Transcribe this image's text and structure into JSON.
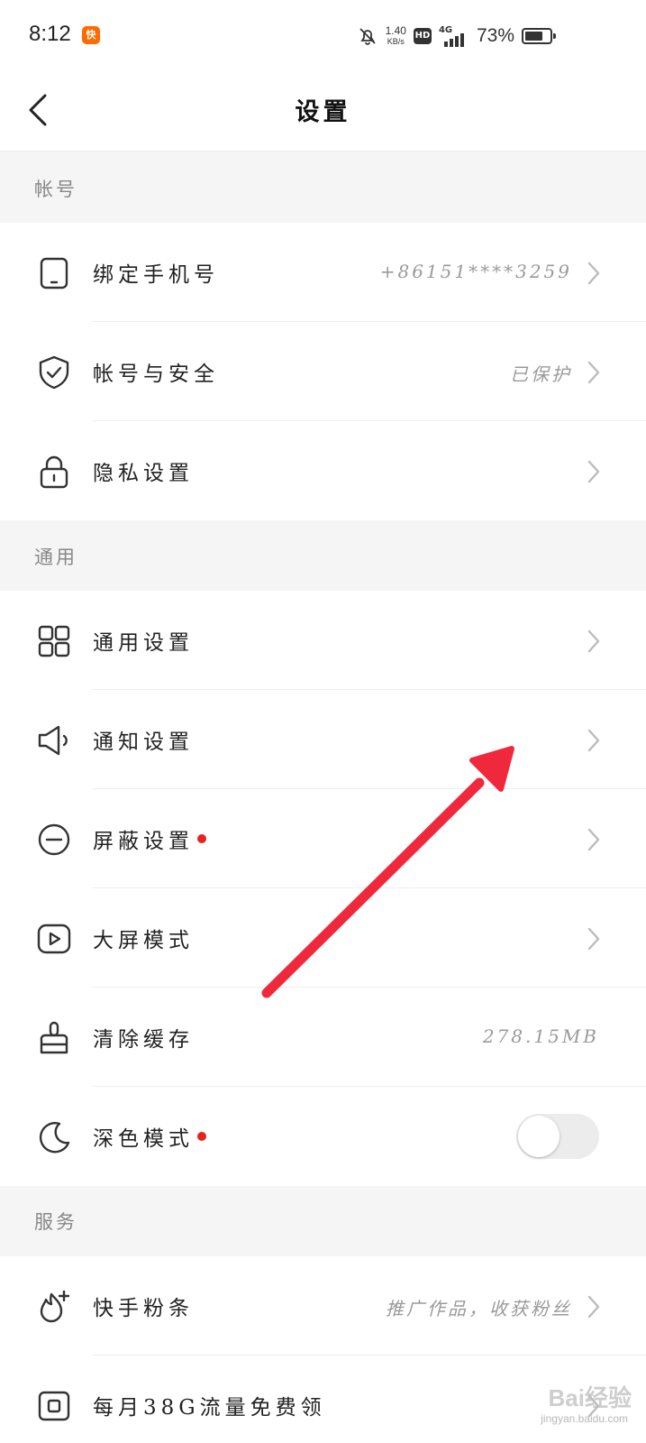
{
  "status_bar": {
    "time": "8:12",
    "app_icon": "kuaishou-app-icon",
    "net_speed_value": "1.40",
    "net_speed_unit": "KB/s",
    "hd_badge": "HD",
    "network_type": "4G",
    "battery_percent": "73%",
    "battery_level": 0.73
  },
  "header": {
    "title": "设置",
    "back_icon": "chevron-left-icon"
  },
  "sections": {
    "account": {
      "title": "帐号",
      "items": [
        {
          "label": "绑定手机号",
          "value": "+86151****3259",
          "icon": "phone-icon"
        },
        {
          "label": "帐号与安全",
          "value": "已保护",
          "icon": "shield-check-icon"
        },
        {
          "label": "隐私设置",
          "value": "",
          "icon": "lock-icon"
        }
      ]
    },
    "general": {
      "title": "通用",
      "items": [
        {
          "label": "通用设置",
          "icon": "grid-icon"
        },
        {
          "label": "通知设置",
          "icon": "speaker-icon"
        },
        {
          "label": "屏蔽设置",
          "icon": "minus-circle-icon",
          "has_dot": true
        },
        {
          "label": "大屏模式",
          "icon": "play-screen-icon"
        },
        {
          "label": "清除缓存",
          "value": "278.15MB",
          "icon": "brush-icon"
        },
        {
          "label": "深色模式",
          "icon": "moon-icon",
          "has_dot": true,
          "toggle_on": false
        }
      ]
    },
    "services": {
      "title": "服务",
      "items": [
        {
          "label": "快手粉条",
          "value": "推广作品，收获粉丝",
          "icon": "flame-plus-icon"
        },
        {
          "label": "每月38G流量免费领",
          "icon": "sim-card-icon"
        }
      ]
    }
  },
  "colors": {
    "accent_red": "#e8231c",
    "arrow_red": "#f0283c",
    "section_bg": "#f5f5f5",
    "app_icon_orange": "#ff6a00"
  },
  "watermark": {
    "text": "Bai经验",
    "sub": "jingyan.baidu.com"
  }
}
